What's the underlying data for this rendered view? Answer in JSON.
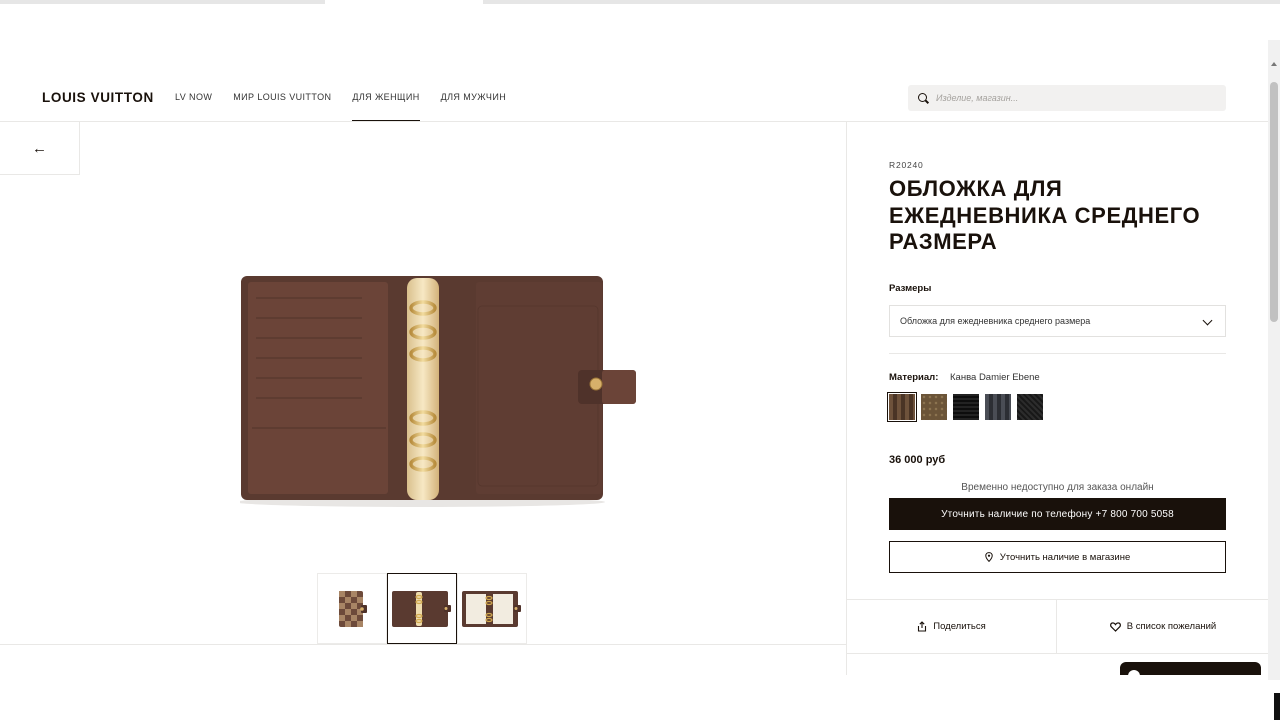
{
  "header": {
    "logo": "LOUIS VUITTON",
    "nav": [
      "LV NOW",
      "МИР LOUIS VUITTON",
      "ДЛЯ ЖЕНЩИН",
      "ДЛЯ МУЖЧИН"
    ],
    "active_nav": "ДЛЯ ЖЕНЩИН",
    "search_placeholder": "Изделие, магазин..."
  },
  "gallery": {
    "back_arrow": "←",
    "thumbnails": [
      "closed-front",
      "open-rings",
      "open-with-pages"
    ],
    "active_thumbnail": 1
  },
  "product": {
    "sku": "R20240",
    "title": "ОБЛОЖКА ДЛЯ ЕЖЕДНЕВНИКА СРЕДНЕГО РАЗМЕРА",
    "sizes_label": "Размеры",
    "size_selected": "Обложка для ежедневника среднего размера",
    "material_label": "Материал:",
    "material_value": "Канва Damier Ebene",
    "swatches": [
      {
        "name": "damier-ebene",
        "color": "#5b4431"
      },
      {
        "name": "monogram",
        "color": "#6b5438"
      },
      {
        "name": "epi-black",
        "color": "#141414"
      },
      {
        "name": "damier-graphite",
        "color": "#3a3d45"
      },
      {
        "name": "taiga-black",
        "color": "#222222"
      }
    ],
    "price": "36 000 руб",
    "unavailable_text": "Временно недоступно для заказа онлайн",
    "phone_button": "Уточнить наличие по телефону +7 800 700 5058",
    "store_button": "Уточнить наличие в магазине",
    "share": "Поделиться",
    "wishlist": "В список пожеланий"
  },
  "colors": {
    "brand_dark": "#19110b",
    "canvas_brown": "#5c3a2e",
    "brass": "#e3c98a"
  }
}
